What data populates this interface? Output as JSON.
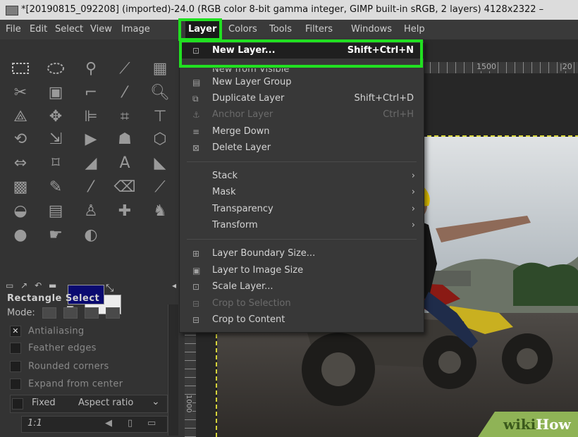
{
  "window": {
    "title": "*[20190815_092208] (imported)-24.0 (RGB color 8-bit gamma integer, GIMP built-in sRGB, 2 layers) 4128x2322 –"
  },
  "menubar": {
    "items": [
      "File",
      "Edit",
      "Select",
      "View",
      "Image",
      "Layer",
      "Colors",
      "Tools",
      "Filters",
      "Windows",
      "Help"
    ],
    "active": "Layer"
  },
  "layer_menu": {
    "new_layer": {
      "label": "New Layer...",
      "shortcut": "Shift+Ctrl+N"
    },
    "clipped_item": "New from Visible",
    "new_layer_group": {
      "label": "New Layer Group"
    },
    "duplicate_layer": {
      "label": "Duplicate Layer",
      "shortcut": "Shift+Ctrl+D"
    },
    "anchor_layer": {
      "label": "Anchor Layer",
      "shortcut": "Ctrl+H"
    },
    "merge_down": {
      "label": "Merge Down"
    },
    "delete_layer": {
      "label": "Delete Layer"
    },
    "stack": {
      "label": "Stack"
    },
    "mask": {
      "label": "Mask"
    },
    "transparency": {
      "label": "Transparency"
    },
    "transform": {
      "label": "Transform"
    },
    "layer_boundary_size": {
      "label": "Layer Boundary Size..."
    },
    "layer_to_image_size": {
      "label": "Layer to Image Size"
    },
    "scale_layer": {
      "label": "Scale Layer..."
    },
    "crop_to_selection": {
      "label": "Crop to Selection"
    },
    "crop_to_content": {
      "label": "Crop to Content"
    }
  },
  "tool_options": {
    "title": "Rectangle Select",
    "mode_label": "Mode:",
    "antialiasing": "Antialiasing",
    "feather_edges": "Feather edges",
    "rounded_corners": "Rounded corners",
    "expand_from_center": "Expand from center",
    "fixed": "Fixed",
    "aspect_ratio": "Aspect ratio",
    "ratio_value": "1:1"
  },
  "colors": {
    "foreground": "#0a0a70",
    "background": "#ececec",
    "highlight": "#21e021"
  },
  "ruler": {
    "top_label": "1500",
    "top_label_2": "|20",
    "left_label": "1000"
  },
  "watermark": {
    "part1": "wiki",
    "part2": "How"
  }
}
